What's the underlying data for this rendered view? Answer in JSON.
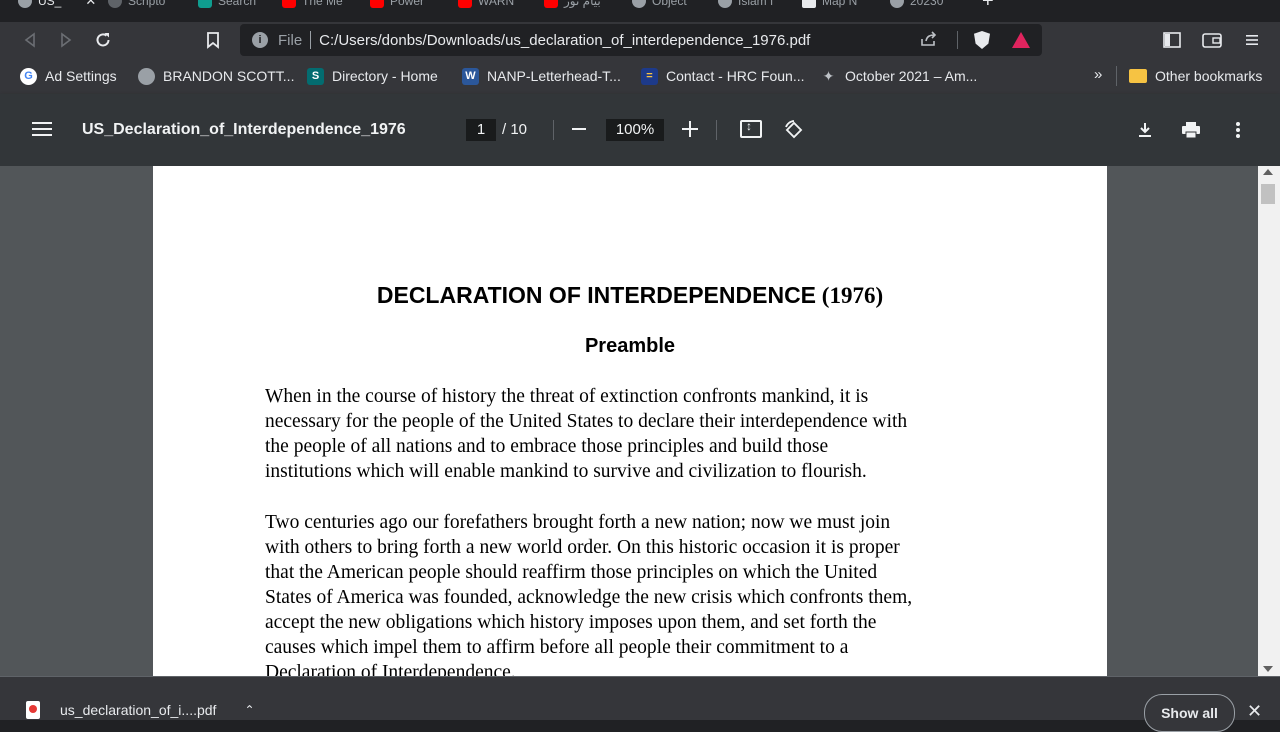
{
  "tabs": [
    {
      "label": "US_",
      "active": true
    },
    {
      "label": "Scripto"
    },
    {
      "label": "Search"
    },
    {
      "label": "The Me"
    },
    {
      "label": "Power"
    },
    {
      "label": "WARN"
    },
    {
      "label": "بيام نور"
    },
    {
      "label": "Object"
    },
    {
      "label": "Islam f"
    },
    {
      "label": "Map N"
    },
    {
      "label": "20230"
    }
  ],
  "tab_close": "✕",
  "new_tab": "+",
  "omnibox": {
    "scheme": "File",
    "url": "C:/Users/donbs/Downloads/us_declaration_of_interdependence_1976.pdf"
  },
  "bookmarks": [
    {
      "label": "Ad Settings",
      "icon": "G"
    },
    {
      "label": "BRANDON SCOTT...",
      "icon": "globe"
    },
    {
      "label": "Directory - Home",
      "icon": "S"
    },
    {
      "label": "NANP-Letterhead-T...",
      "icon": "W"
    },
    {
      "label": "Contact - HRC Foun...",
      "icon": "="
    },
    {
      "label": "October 2021 – Am...",
      "icon": "bird"
    }
  ],
  "bookmarks_more": "»",
  "other_bookmarks": "Other bookmarks",
  "pdf_toolbar": {
    "title": "US_Declaration_of_Interdependence_1976",
    "current_page": "1",
    "total_pages": "/ 10",
    "zoom": "100%"
  },
  "document": {
    "title_sans": "DECLARATION OF INTERDEPENDENCE",
    "title_serif": " (1976)",
    "heading": "Preamble",
    "paragraph1": [
      "When in the course of history the threat of extinction confronts mankind, it is",
      "necessary for the people of the United States to declare their interdependence with",
      "the people of all nations and to embrace those principles and build those",
      "institutions which will enable mankind to survive and civilization to flourish."
    ],
    "paragraph2": [
      "Two centuries ago our forefathers brought forth a new nation; now we must join",
      "with others to bring forth a new world order. On this historic occasion it is proper",
      "that the American people should reaffirm those principles on which the United",
      "States of America was founded, acknowledge the new crisis which confronts them,",
      "accept the new obligations which history imposes upon them, and set forth the",
      "causes which impel them to affirm before all people their commitment to a",
      "Declaration of Interdependence."
    ]
  },
  "downloads": {
    "file": "us_declaration_of_i....pdf",
    "chevron": "⌃",
    "show_all": "Show all",
    "close": "✕"
  },
  "colors": {
    "tab_youtube": "#ff0000",
    "accent_blue": "#4285f4"
  }
}
